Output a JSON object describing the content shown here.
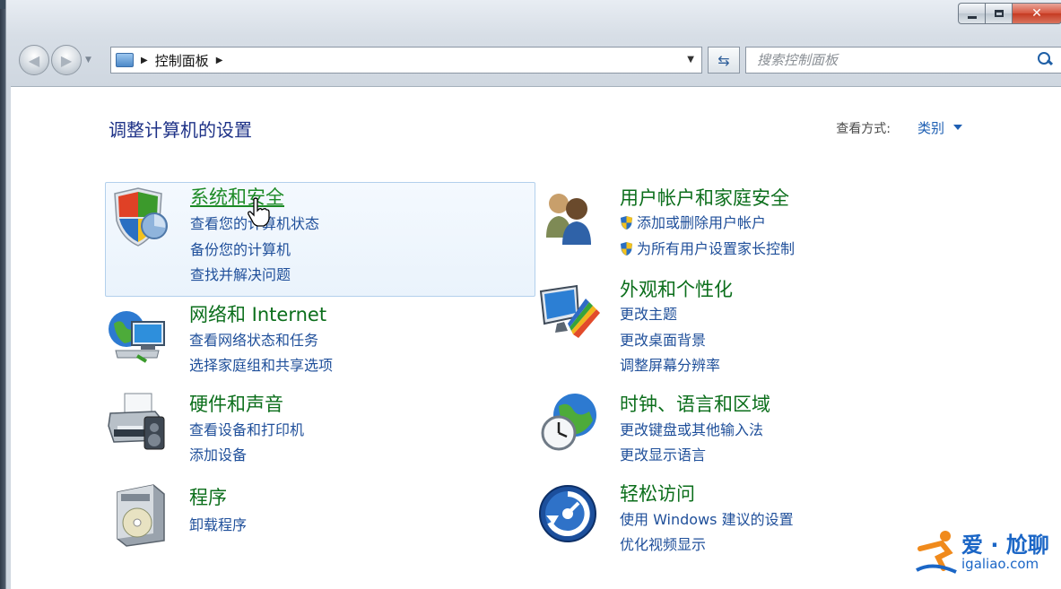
{
  "window": {
    "caption": {
      "minimize": "–",
      "maximize": "□",
      "close": "✕"
    }
  },
  "nav": {
    "breadcrumb": [
      "控制面板"
    ],
    "search_placeholder": "搜索控制面板"
  },
  "header": {
    "title": "调整计算机的设置",
    "view_by_label": "查看方式:",
    "view_by_value": "类别"
  },
  "categories": [
    {
      "title": "系统和安全",
      "links": [
        "查看您的计算机状态",
        "备份您的计算机",
        "查找并解决问题"
      ],
      "icon": "shield-icon"
    },
    {
      "title": "网络和 Internet",
      "links": [
        "查看网络状态和任务",
        "选择家庭组和共享选项"
      ],
      "icon": "network-icon"
    },
    {
      "title": "硬件和声音",
      "links": [
        "查看设备和打印机",
        "添加设备"
      ],
      "icon": "printer-icon"
    },
    {
      "title": "程序",
      "links": [
        "卸载程序"
      ],
      "icon": "programs-icon"
    },
    {
      "title": "用户帐户和家庭安全",
      "links": [
        "添加或删除用户帐户",
        "为所有用户设置家长控制"
      ],
      "icon": "users-icon"
    },
    {
      "title": "外观和个性化",
      "links": [
        "更改主题",
        "更改桌面背景",
        "调整屏幕分辨率"
      ],
      "icon": "appearance-icon"
    },
    {
      "title": "时钟、语言和区域",
      "links": [
        "更改键盘或其他输入法",
        "更改显示语言"
      ],
      "icon": "clock-globe-icon"
    },
    {
      "title": "轻松访问",
      "links": [
        "使用 Windows 建议的设置",
        "优化视频显示"
      ],
      "icon": "ease-of-access-icon"
    }
  ],
  "watermark": {
    "text": "爱 · 尬聊",
    "url": "igaliao.com"
  },
  "colors": {
    "title_blue": "#1e3287",
    "category_green": "#0b6e1b",
    "link_blue": "#1f4f9a"
  }
}
